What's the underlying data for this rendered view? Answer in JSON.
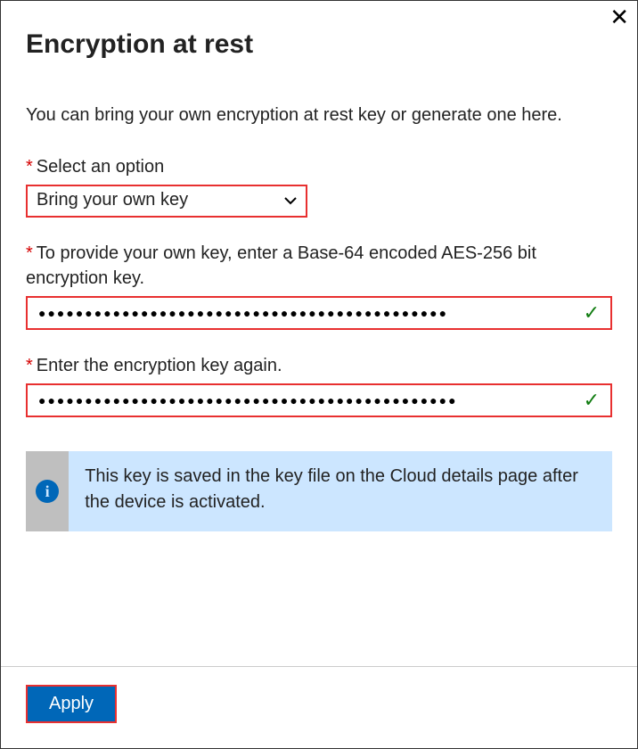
{
  "header": {
    "title": "Encryption at rest",
    "close_label": "✕"
  },
  "description": "You can bring your own encryption at rest key or generate one here.",
  "fields": {
    "option": {
      "label": "Select an option",
      "value": "Bring your own key"
    },
    "key": {
      "label": "To provide your own key, enter a Base-64 encoded AES-256 bit encryption key.",
      "masked": "●●●●●●●●●●●●●●●●●●●●●●●●●●●●●●●●●●●●●●●●●●●●",
      "valid": true
    },
    "confirm": {
      "label": "Enter the encryption key again.",
      "masked": "●●●●●●●●●●●●●●●●●●●●●●●●●●●●●●●●●●●●●●●●●●●●●",
      "valid": true
    }
  },
  "info": {
    "icon_letter": "i",
    "text": "This key is saved in the key file on the Cloud details page after the device is activated."
  },
  "footer": {
    "apply_label": "Apply"
  }
}
